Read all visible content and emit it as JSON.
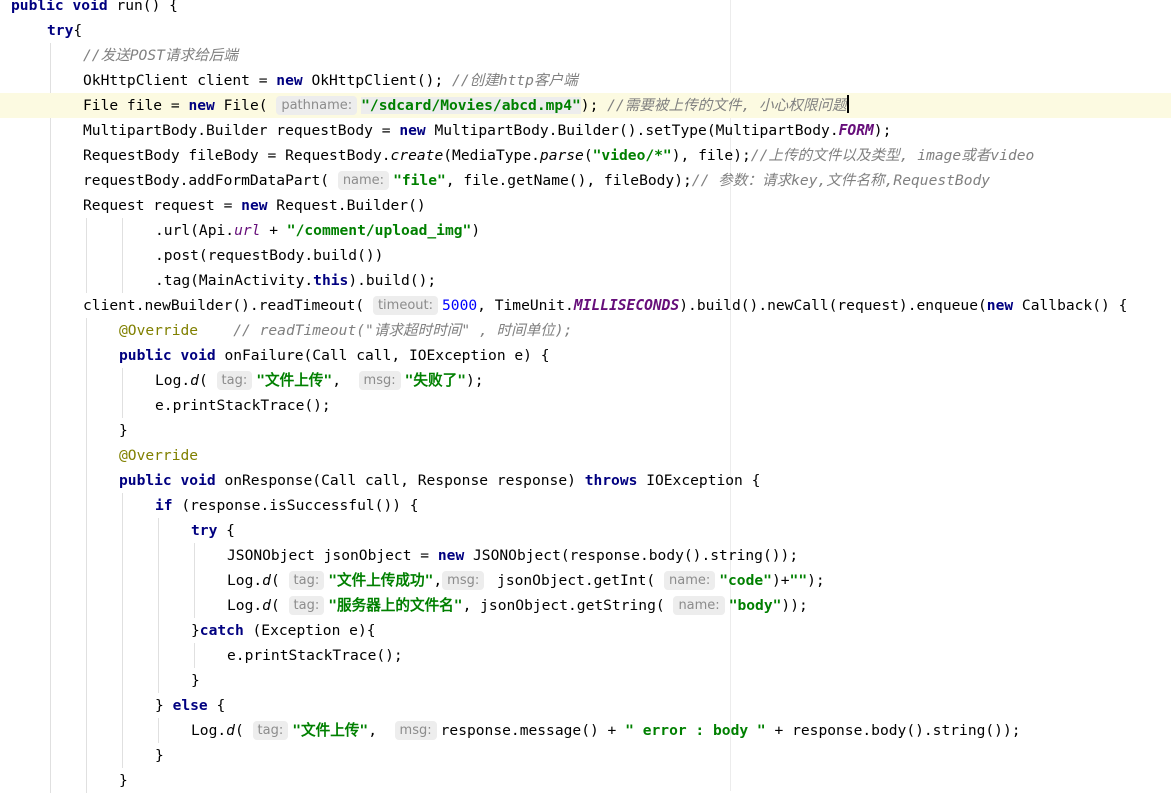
{
  "lines": [
    {
      "indent": 0,
      "tokens": [
        {
          "t": "public void",
          "c": "kw"
        },
        {
          "t": " run() {"
        }
      ]
    },
    {
      "indent": 1,
      "tokens": [
        {
          "t": "try",
          "c": "kw"
        },
        {
          "t": "{"
        }
      ]
    },
    {
      "indent": 2,
      "tokens": [
        {
          "t": "//发送POST请求给后端",
          "c": "cm"
        }
      ]
    },
    {
      "indent": 2,
      "tokens": [
        {
          "t": "OkHttpClient client = "
        },
        {
          "t": "new",
          "c": "kw"
        },
        {
          "t": " OkHttpClient(); "
        },
        {
          "t": "//创建http客户端",
          "c": "cm"
        }
      ]
    },
    {
      "indent": 2,
      "current": true,
      "tokens": [
        {
          "t": "File file = "
        },
        {
          "t": "new",
          "c": "kw"
        },
        {
          "t": " File( "
        },
        {
          "t": "pathname:",
          "c": "hint"
        },
        {
          "t": "\"/sdcard/Movies/abcd.mp4\"",
          "c": "str hl"
        },
        {
          "t": "); "
        },
        {
          "t": "//需要被上传的文件, 小心权限问题",
          "c": "cm"
        },
        {
          "caret": true
        }
      ]
    },
    {
      "indent": 2,
      "tokens": [
        {
          "t": "MultipartBody.Builder requestBody = "
        },
        {
          "t": "new",
          "c": "kw"
        },
        {
          "t": " MultipartBody.Builder().setType(MultipartBody."
        },
        {
          "t": "FORM",
          "c": "konst"
        },
        {
          "t": ");"
        }
      ]
    },
    {
      "indent": 2,
      "tokens": [
        {
          "t": "RequestBody fileBody = RequestBody."
        },
        {
          "t": "create",
          "c": "st"
        },
        {
          "t": "(MediaType."
        },
        {
          "t": "parse",
          "c": "st"
        },
        {
          "t": "("
        },
        {
          "t": "\"video/*\"",
          "c": "str"
        },
        {
          "t": "), file);"
        },
        {
          "t": "//上传的文件以及类型, image或者video",
          "c": "cm"
        }
      ]
    },
    {
      "indent": 2,
      "tokens": [
        {
          "t": "requestBody.addFormDataPart( "
        },
        {
          "t": "name:",
          "c": "hint"
        },
        {
          "t": "\"file\"",
          "c": "str"
        },
        {
          "t": ", file.getName(), fileBody);"
        },
        {
          "t": "// 参数：请求key,文件名称,RequestBody",
          "c": "cm"
        }
      ]
    },
    {
      "indent": 2,
      "tokens": [
        {
          "t": "Request request = "
        },
        {
          "t": "new",
          "c": "kw"
        },
        {
          "t": " Request.Builder()"
        }
      ]
    },
    {
      "indent": 4,
      "tokens": [
        {
          "t": ".url(Api."
        },
        {
          "t": "url",
          "c": "fld"
        },
        {
          "t": " + "
        },
        {
          "t": "\"/comment/upload_img\"",
          "c": "str"
        },
        {
          "t": ")"
        }
      ]
    },
    {
      "indent": 4,
      "tokens": [
        {
          "t": ".post(requestBody.build())"
        }
      ]
    },
    {
      "indent": 4,
      "tokens": [
        {
          "t": ".tag(MainActivity."
        },
        {
          "t": "this",
          "c": "kw"
        },
        {
          "t": ").build();"
        }
      ]
    },
    {
      "indent": 2,
      "tokens": [
        {
          "t": "client.newBuilder().readTimeout( "
        },
        {
          "t": "timeout:",
          "c": "hint"
        },
        {
          "t": "5000",
          "c": "num"
        },
        {
          "t": ", TimeUnit."
        },
        {
          "t": "MILLISECONDS",
          "c": "konst"
        },
        {
          "t": ").build().newCall(request).enqueue("
        },
        {
          "t": "new",
          "c": "kw"
        },
        {
          "t": " Callback() {"
        }
      ]
    },
    {
      "indent": 3,
      "tokens": [
        {
          "t": "@Override",
          "c": "ann"
        },
        {
          "t": "    "
        },
        {
          "t": "// readTimeout(\"请求超时时间\" , 时间单位);",
          "c": "cm"
        }
      ]
    },
    {
      "indent": 3,
      "tokens": [
        {
          "t": "public void",
          "c": "kw"
        },
        {
          "t": " onFailure(Call call, IOException e) {"
        }
      ]
    },
    {
      "indent": 4,
      "tokens": [
        {
          "t": "Log."
        },
        {
          "t": "d",
          "c": "st"
        },
        {
          "t": "( "
        },
        {
          "t": "tag:",
          "c": "hint"
        },
        {
          "t": "\"文件上传\"",
          "c": "str"
        },
        {
          "t": ",  "
        },
        {
          "t": "msg:",
          "c": "hint"
        },
        {
          "t": "\"失败了\"",
          "c": "str"
        },
        {
          "t": ");"
        }
      ]
    },
    {
      "indent": 4,
      "tokens": [
        {
          "t": "e.printStackTrace();"
        }
      ]
    },
    {
      "indent": 3,
      "tokens": [
        {
          "t": "}"
        }
      ]
    },
    {
      "indent": 3,
      "tokens": [
        {
          "t": "@Override",
          "c": "ann"
        }
      ]
    },
    {
      "indent": 3,
      "tokens": [
        {
          "t": "public void",
          "c": "kw"
        },
        {
          "t": " onResponse(Call call, Response response) "
        },
        {
          "t": "throws",
          "c": "kw"
        },
        {
          "t": " IOException {"
        }
      ]
    },
    {
      "indent": 4,
      "tokens": [
        {
          "t": "if",
          "c": "kw"
        },
        {
          "t": " (response.isSuccessful()) {"
        }
      ]
    },
    {
      "indent": 5,
      "tokens": [
        {
          "t": "try",
          "c": "kw"
        },
        {
          "t": " {"
        }
      ]
    },
    {
      "indent": 6,
      "tokens": [
        {
          "t": "JSONObject jsonObject = "
        },
        {
          "t": "new",
          "c": "kw"
        },
        {
          "t": " JSONObject(response.body().string());"
        }
      ]
    },
    {
      "indent": 6,
      "tokens": [
        {
          "t": "Log."
        },
        {
          "t": "d",
          "c": "st"
        },
        {
          "t": "( "
        },
        {
          "t": "tag:",
          "c": "hint"
        },
        {
          "t": "\"文件上传成功\"",
          "c": "str"
        },
        {
          "t": ","
        },
        {
          "t": "msg:",
          "c": "hint"
        },
        {
          "t": " jsonObject.getInt( "
        },
        {
          "t": "name:",
          "c": "hint"
        },
        {
          "t": "\"code\"",
          "c": "str"
        },
        {
          "t": ")+"
        },
        {
          "t": "\"\"",
          "c": "str"
        },
        {
          "t": ");"
        }
      ]
    },
    {
      "indent": 6,
      "tokens": [
        {
          "t": "Log."
        },
        {
          "t": "d",
          "c": "st"
        },
        {
          "t": "( "
        },
        {
          "t": "tag:",
          "c": "hint"
        },
        {
          "t": "\"服务器上的文件名\"",
          "c": "str"
        },
        {
          "t": ", jsonObject.getString( "
        },
        {
          "t": "name:",
          "c": "hint"
        },
        {
          "t": "\"body\"",
          "c": "str"
        },
        {
          "t": "));"
        }
      ]
    },
    {
      "indent": 5,
      "tokens": [
        {
          "t": "}"
        },
        {
          "t": "catch",
          "c": "kw"
        },
        {
          "t": " (Exception e){"
        }
      ]
    },
    {
      "indent": 6,
      "tokens": [
        {
          "t": "e.printStackTrace();"
        }
      ]
    },
    {
      "indent": 5,
      "tokens": [
        {
          "t": "}"
        }
      ]
    },
    {
      "indent": 4,
      "tokens": [
        {
          "t": "} "
        },
        {
          "t": "else",
          "c": "kw"
        },
        {
          "t": " {"
        }
      ]
    },
    {
      "indent": 5,
      "tokens": [
        {
          "t": "Log."
        },
        {
          "t": "d",
          "c": "st"
        },
        {
          "t": "( "
        },
        {
          "t": "tag:",
          "c": "hint"
        },
        {
          "t": "\"文件上传\"",
          "c": "str"
        },
        {
          "t": ",  "
        },
        {
          "t": "msg:",
          "c": "hint"
        },
        {
          "t": "response.message() + "
        },
        {
          "t": "\" error : body \"",
          "c": "str"
        },
        {
          "t": " + response.body().string());"
        }
      ]
    },
    {
      "indent": 4,
      "tokens": [
        {
          "t": "}"
        }
      ]
    },
    {
      "indent": 3,
      "tokens": [
        {
          "t": "}"
        }
      ]
    }
  ],
  "colors": {
    "keyword": "#000080",
    "string": "#008000",
    "number": "#0000ff",
    "comment": "#808080",
    "annotation": "#808000",
    "field": "#660e7a",
    "current_line": "#fcfae1",
    "hint_background": "#ededed"
  }
}
